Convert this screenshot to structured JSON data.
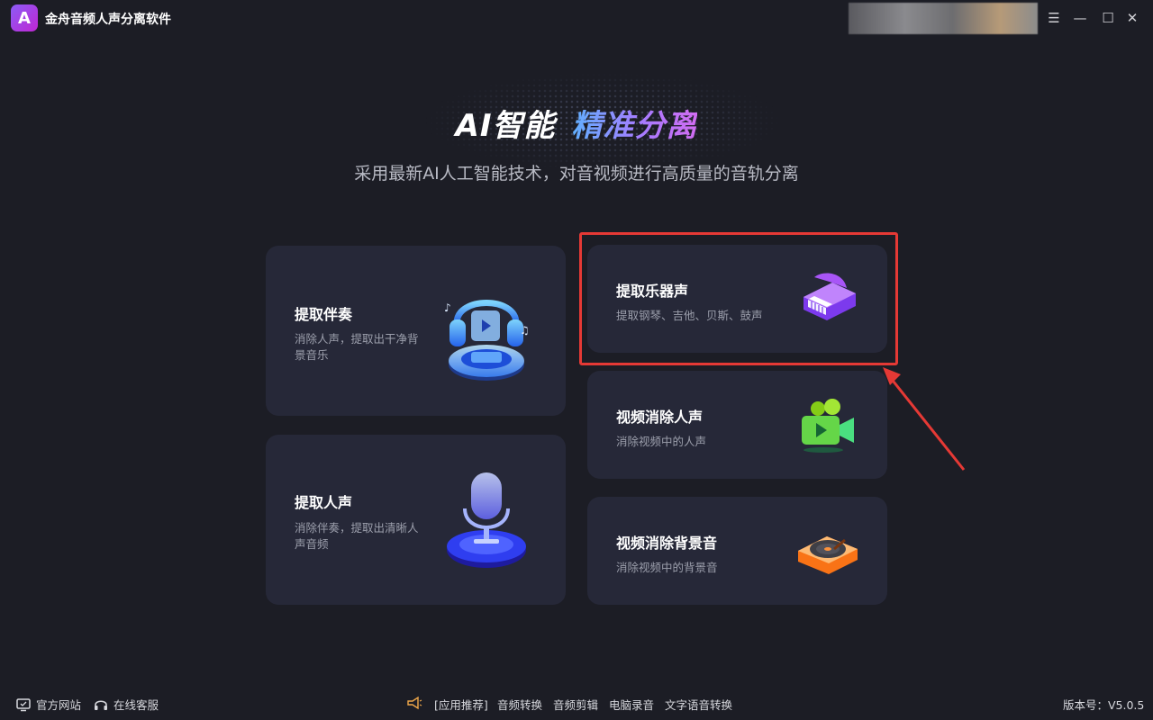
{
  "app": {
    "title": "金舟音频人声分离软件",
    "logo_letter": "A"
  },
  "window_controls": {
    "menu_icon": "☰",
    "min_icon": "—",
    "max_icon": "☐",
    "close_icon": "✕"
  },
  "hero": {
    "title_part1": "AI智能",
    "title_part2": "精准分离",
    "subtitle": "采用最新AI人工智能技术，对音视频进行高质量的音轨分离"
  },
  "cards": {
    "accompaniment": {
      "title": "提取伴奏",
      "desc": "消除人声，提取出干净背景音乐",
      "icon": "headphones-icon"
    },
    "vocal": {
      "title": "提取人声",
      "desc": "消除伴奏，提取出清晰人声音频",
      "icon": "microphone-icon"
    },
    "instrument": {
      "title": "提取乐器声",
      "desc": "提取钢琴、吉他、贝斯、鼓声",
      "icon": "piano-icon"
    },
    "video_vocal": {
      "title": "视频消除人声",
      "desc": "消除视频中的人声",
      "icon": "video-camera-icon"
    },
    "video_bg": {
      "title": "视频消除背景音",
      "desc": "消除视频中的背景音",
      "icon": "turntable-icon"
    }
  },
  "footer": {
    "website": "官方网站",
    "support": "在线客服",
    "recommend_label": "[应用推荐]",
    "apps": [
      "音频转换",
      "音频剪辑",
      "电脑录音",
      "文字语音转换"
    ],
    "version": "版本号：V5.0.5"
  },
  "colors": {
    "background": "#1c1d25",
    "card": "#262838",
    "highlight": "#e53935",
    "accent": "#8b5cf6"
  }
}
